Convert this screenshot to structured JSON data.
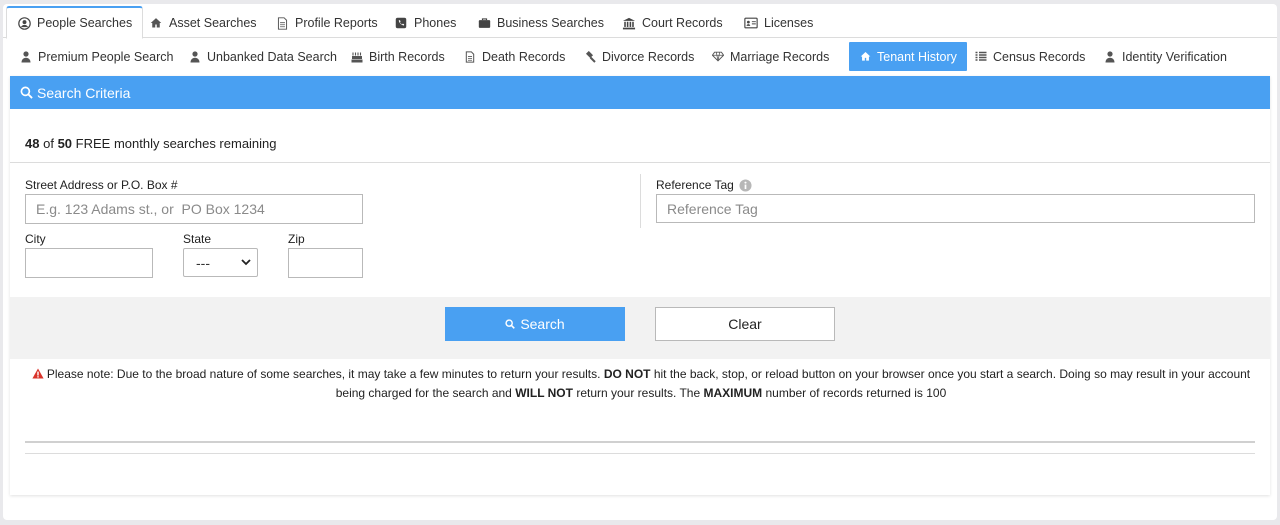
{
  "top_tabs": [
    {
      "label": "People Searches",
      "icon": "user-circle-icon",
      "active": true
    },
    {
      "label": "Asset Searches",
      "icon": "home-icon"
    },
    {
      "label": "Profile Reports",
      "icon": "document-icon"
    },
    {
      "label": "Phones",
      "icon": "phone-icon"
    },
    {
      "label": "Business Searches",
      "icon": "briefcase-icon"
    },
    {
      "label": "Court Records",
      "icon": "courthouse-icon"
    },
    {
      "label": "Licenses",
      "icon": "id-card-icon"
    }
  ],
  "sub_tabs": [
    {
      "label": "Premium People Search",
      "icon": "user-icon"
    },
    {
      "label": "Unbanked Data Search",
      "icon": "user-icon"
    },
    {
      "label": "Birth Records",
      "icon": "cake-icon"
    },
    {
      "label": "Death Records",
      "icon": "document-icon"
    },
    {
      "label": "Divorce Records",
      "icon": "gavel-icon"
    },
    {
      "label": "Marriage Records",
      "icon": "diamond-icon"
    },
    {
      "label": "Tenant History",
      "icon": "home-icon",
      "active": true
    },
    {
      "label": "Census Records",
      "icon": "list-icon"
    },
    {
      "label": "Identity Verification",
      "icon": "user-icon"
    }
  ],
  "card": {
    "title": "Search Criteria",
    "remaining": {
      "used": "48",
      "of": "of",
      "total": "50",
      "suffix": "FREE monthly searches remaining"
    }
  },
  "form": {
    "street_label": "Street Address or P.O. Box #",
    "street_placeholder": "E.g. 123 Adams st., or  PO Box 1234",
    "street_value": "",
    "reference_label": "Reference Tag",
    "reference_placeholder": "Reference Tag",
    "reference_value": "",
    "city_label": "City",
    "city_value": "",
    "state_label": "State",
    "state_value": "---",
    "zip_label": "Zip",
    "zip_value": ""
  },
  "buttons": {
    "search": "Search",
    "clear": "Clear"
  },
  "note": {
    "p1": "Please note: Due to the broad nature of some searches, it may take a few minutes to return your results. ",
    "b1": "DO NOT",
    "p2": " hit the back, stop, or reload button on your browser once you start a search. Doing so may result in your account being charged for the search and ",
    "b2": "WILL NOT",
    "p3": " return your results. The ",
    "b3": "MAXIMUM",
    "p4": " number of records returned is 100"
  },
  "colors": {
    "accent": "#49a0f2",
    "warning": "#d9342b"
  }
}
